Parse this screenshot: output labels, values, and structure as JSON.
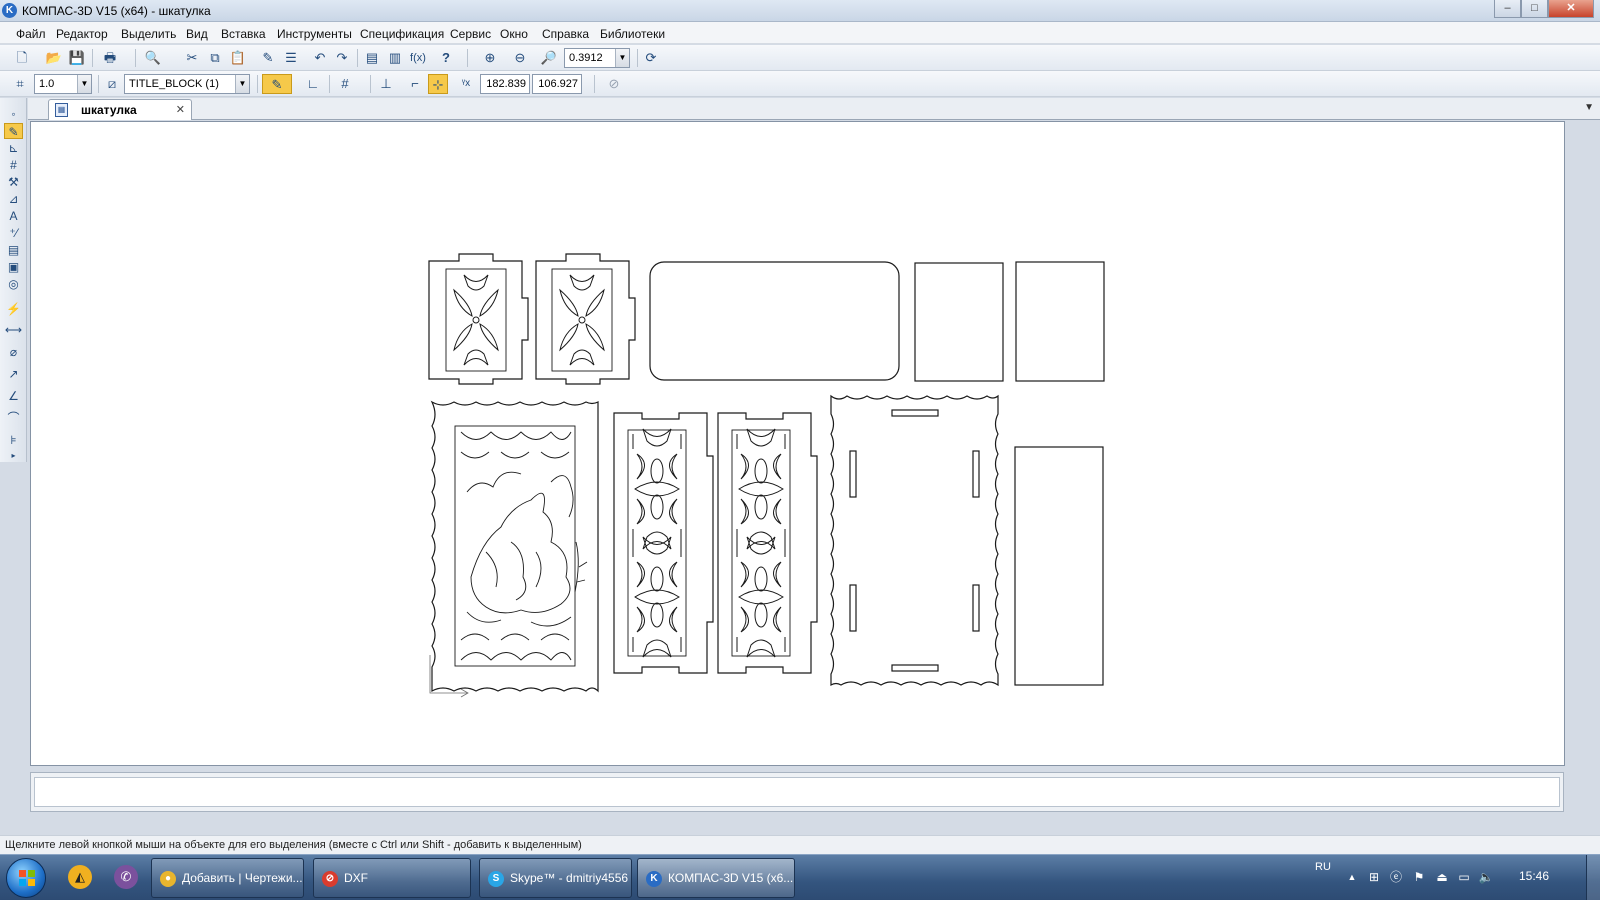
{
  "window": {
    "title": "КОМПАС-3D V15 (x64) - шкатулка",
    "app_icon_letter": "K",
    "minimize": "–",
    "maximize": "□",
    "close": "✕"
  },
  "menu": [
    "Файл",
    "Редактор",
    "Выделить",
    "Вид",
    "Вставка",
    "Инструменты",
    "Спецификация",
    "Сервис",
    "Окно",
    "Справка",
    "Библиотеки"
  ],
  "toolbar_main": {
    "zoom_value": "0.3912",
    "fx_label": "f(x)",
    "help_label": "?"
  },
  "toolbar_current": {
    "step_value": "1.0",
    "layer_value": "TITLE_BLOCK (1)",
    "coord_x": "182.839",
    "coord_y": "106.927"
  },
  "document_tab": {
    "title": "шкатулка",
    "close": "✕"
  },
  "status": {
    "hint": "Щелкните левой кнопкой мыши на объекте для его выделения (вместе с Ctrl или Shift - добавить к выделенным)"
  },
  "taskbar": {
    "tasks": [
      {
        "label": "Добавить | Чертежи...",
        "icon": "chrome-icon",
        "icon_color": "#e8b52e"
      },
      {
        "label": "DXF",
        "icon": "block-icon",
        "icon_color": "#d93c2e"
      },
      {
        "label": "Skype™ - dmitriy4556",
        "icon": "skype-icon",
        "icon_color": "#2aa6e6"
      },
      {
        "label": "КОМПАС-3D V15 (x6...",
        "icon": "kompas-icon",
        "icon_color": "#2a6cc4"
      }
    ],
    "language": "RU",
    "clock": "15:46"
  },
  "colors": {
    "accent_active": "#f6c94a",
    "drawing_stroke": "#1a1a1a"
  }
}
